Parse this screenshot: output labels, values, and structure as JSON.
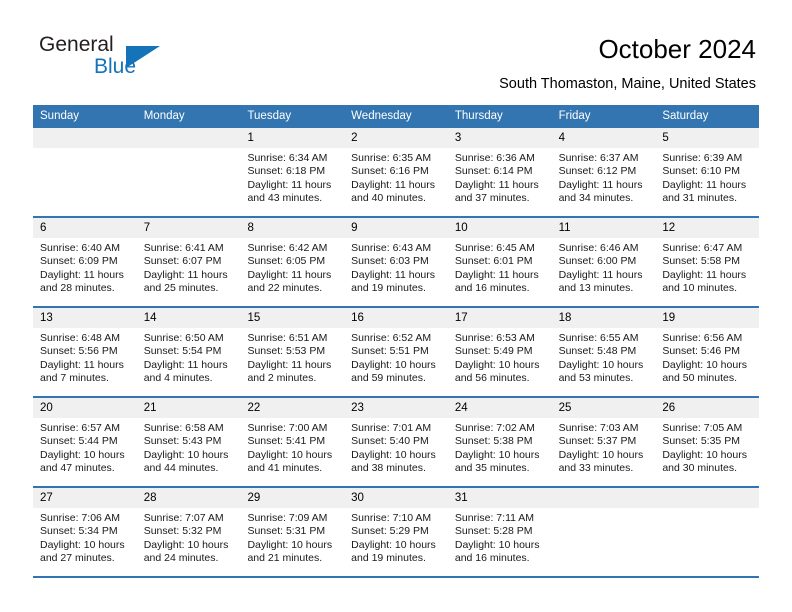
{
  "brand": {
    "name_top": "General",
    "name_bottom": "Blue",
    "triangle_color": "#1573b9"
  },
  "header": {
    "title": "October 2024",
    "subtitle": "South Thomaston, Maine, United States",
    "accent_color": "#3275b0",
    "daynum_band_color": "#f0f0f0"
  },
  "weekdays": [
    {
      "label": "Sunday"
    },
    {
      "label": "Monday"
    },
    {
      "label": "Tuesday"
    },
    {
      "label": "Wednesday"
    },
    {
      "label": "Thursday"
    },
    {
      "label": "Friday"
    },
    {
      "label": "Saturday"
    }
  ],
  "labels": {
    "sunrise": "Sunrise:",
    "sunset": "Sunset:",
    "daylight": "Daylight:"
  },
  "weeks": [
    {
      "days": [
        {
          "num": "",
          "empty": true
        },
        {
          "num": "",
          "empty": true
        },
        {
          "num": "1",
          "sunrise": "Sunrise: 6:34 AM",
          "sunset": "Sunset: 6:18 PM",
          "daylight_1": "Daylight: 11 hours",
          "daylight_2": "and 43 minutes."
        },
        {
          "num": "2",
          "sunrise": "Sunrise: 6:35 AM",
          "sunset": "Sunset: 6:16 PM",
          "daylight_1": "Daylight: 11 hours",
          "daylight_2": "and 40 minutes."
        },
        {
          "num": "3",
          "sunrise": "Sunrise: 6:36 AM",
          "sunset": "Sunset: 6:14 PM",
          "daylight_1": "Daylight: 11 hours",
          "daylight_2": "and 37 minutes."
        },
        {
          "num": "4",
          "sunrise": "Sunrise: 6:37 AM",
          "sunset": "Sunset: 6:12 PM",
          "daylight_1": "Daylight: 11 hours",
          "daylight_2": "and 34 minutes."
        },
        {
          "num": "5",
          "sunrise": "Sunrise: 6:39 AM",
          "sunset": "Sunset: 6:10 PM",
          "daylight_1": "Daylight: 11 hours",
          "daylight_2": "and 31 minutes."
        }
      ]
    },
    {
      "days": [
        {
          "num": "6",
          "sunrise": "Sunrise: 6:40 AM",
          "sunset": "Sunset: 6:09 PM",
          "daylight_1": "Daylight: 11 hours",
          "daylight_2": "and 28 minutes."
        },
        {
          "num": "7",
          "sunrise": "Sunrise: 6:41 AM",
          "sunset": "Sunset: 6:07 PM",
          "daylight_1": "Daylight: 11 hours",
          "daylight_2": "and 25 minutes."
        },
        {
          "num": "8",
          "sunrise": "Sunrise: 6:42 AM",
          "sunset": "Sunset: 6:05 PM",
          "daylight_1": "Daylight: 11 hours",
          "daylight_2": "and 22 minutes."
        },
        {
          "num": "9",
          "sunrise": "Sunrise: 6:43 AM",
          "sunset": "Sunset: 6:03 PM",
          "daylight_1": "Daylight: 11 hours",
          "daylight_2": "and 19 minutes."
        },
        {
          "num": "10",
          "sunrise": "Sunrise: 6:45 AM",
          "sunset": "Sunset: 6:01 PM",
          "daylight_1": "Daylight: 11 hours",
          "daylight_2": "and 16 minutes."
        },
        {
          "num": "11",
          "sunrise": "Sunrise: 6:46 AM",
          "sunset": "Sunset: 6:00 PM",
          "daylight_1": "Daylight: 11 hours",
          "daylight_2": "and 13 minutes."
        },
        {
          "num": "12",
          "sunrise": "Sunrise: 6:47 AM",
          "sunset": "Sunset: 5:58 PM",
          "daylight_1": "Daylight: 11 hours",
          "daylight_2": "and 10 minutes."
        }
      ]
    },
    {
      "days": [
        {
          "num": "13",
          "sunrise": "Sunrise: 6:48 AM",
          "sunset": "Sunset: 5:56 PM",
          "daylight_1": "Daylight: 11 hours",
          "daylight_2": "and 7 minutes."
        },
        {
          "num": "14",
          "sunrise": "Sunrise: 6:50 AM",
          "sunset": "Sunset: 5:54 PM",
          "daylight_1": "Daylight: 11 hours",
          "daylight_2": "and 4 minutes."
        },
        {
          "num": "15",
          "sunrise": "Sunrise: 6:51 AM",
          "sunset": "Sunset: 5:53 PM",
          "daylight_1": "Daylight: 11 hours",
          "daylight_2": "and 2 minutes."
        },
        {
          "num": "16",
          "sunrise": "Sunrise: 6:52 AM",
          "sunset": "Sunset: 5:51 PM",
          "daylight_1": "Daylight: 10 hours",
          "daylight_2": "and 59 minutes."
        },
        {
          "num": "17",
          "sunrise": "Sunrise: 6:53 AM",
          "sunset": "Sunset: 5:49 PM",
          "daylight_1": "Daylight: 10 hours",
          "daylight_2": "and 56 minutes."
        },
        {
          "num": "18",
          "sunrise": "Sunrise: 6:55 AM",
          "sunset": "Sunset: 5:48 PM",
          "daylight_1": "Daylight: 10 hours",
          "daylight_2": "and 53 minutes."
        },
        {
          "num": "19",
          "sunrise": "Sunrise: 6:56 AM",
          "sunset": "Sunset: 5:46 PM",
          "daylight_1": "Daylight: 10 hours",
          "daylight_2": "and 50 minutes."
        }
      ]
    },
    {
      "days": [
        {
          "num": "20",
          "sunrise": "Sunrise: 6:57 AM",
          "sunset": "Sunset: 5:44 PM",
          "daylight_1": "Daylight: 10 hours",
          "daylight_2": "and 47 minutes."
        },
        {
          "num": "21",
          "sunrise": "Sunrise: 6:58 AM",
          "sunset": "Sunset: 5:43 PM",
          "daylight_1": "Daylight: 10 hours",
          "daylight_2": "and 44 minutes."
        },
        {
          "num": "22",
          "sunrise": "Sunrise: 7:00 AM",
          "sunset": "Sunset: 5:41 PM",
          "daylight_1": "Daylight: 10 hours",
          "daylight_2": "and 41 minutes."
        },
        {
          "num": "23",
          "sunrise": "Sunrise: 7:01 AM",
          "sunset": "Sunset: 5:40 PM",
          "daylight_1": "Daylight: 10 hours",
          "daylight_2": "and 38 minutes."
        },
        {
          "num": "24",
          "sunrise": "Sunrise: 7:02 AM",
          "sunset": "Sunset: 5:38 PM",
          "daylight_1": "Daylight: 10 hours",
          "daylight_2": "and 35 minutes."
        },
        {
          "num": "25",
          "sunrise": "Sunrise: 7:03 AM",
          "sunset": "Sunset: 5:37 PM",
          "daylight_1": "Daylight: 10 hours",
          "daylight_2": "and 33 minutes."
        },
        {
          "num": "26",
          "sunrise": "Sunrise: 7:05 AM",
          "sunset": "Sunset: 5:35 PM",
          "daylight_1": "Daylight: 10 hours",
          "daylight_2": "and 30 minutes."
        }
      ]
    },
    {
      "days": [
        {
          "num": "27",
          "sunrise": "Sunrise: 7:06 AM",
          "sunset": "Sunset: 5:34 PM",
          "daylight_1": "Daylight: 10 hours",
          "daylight_2": "and 27 minutes."
        },
        {
          "num": "28",
          "sunrise": "Sunrise: 7:07 AM",
          "sunset": "Sunset: 5:32 PM",
          "daylight_1": "Daylight: 10 hours",
          "daylight_2": "and 24 minutes."
        },
        {
          "num": "29",
          "sunrise": "Sunrise: 7:09 AM",
          "sunset": "Sunset: 5:31 PM",
          "daylight_1": "Daylight: 10 hours",
          "daylight_2": "and 21 minutes."
        },
        {
          "num": "30",
          "sunrise": "Sunrise: 7:10 AM",
          "sunset": "Sunset: 5:29 PM",
          "daylight_1": "Daylight: 10 hours",
          "daylight_2": "and 19 minutes."
        },
        {
          "num": "31",
          "sunrise": "Sunrise: 7:11 AM",
          "sunset": "Sunset: 5:28 PM",
          "daylight_1": "Daylight: 10 hours",
          "daylight_2": "and 16 minutes."
        },
        {
          "num": "",
          "empty": true
        },
        {
          "num": "",
          "empty": true
        }
      ]
    }
  ]
}
